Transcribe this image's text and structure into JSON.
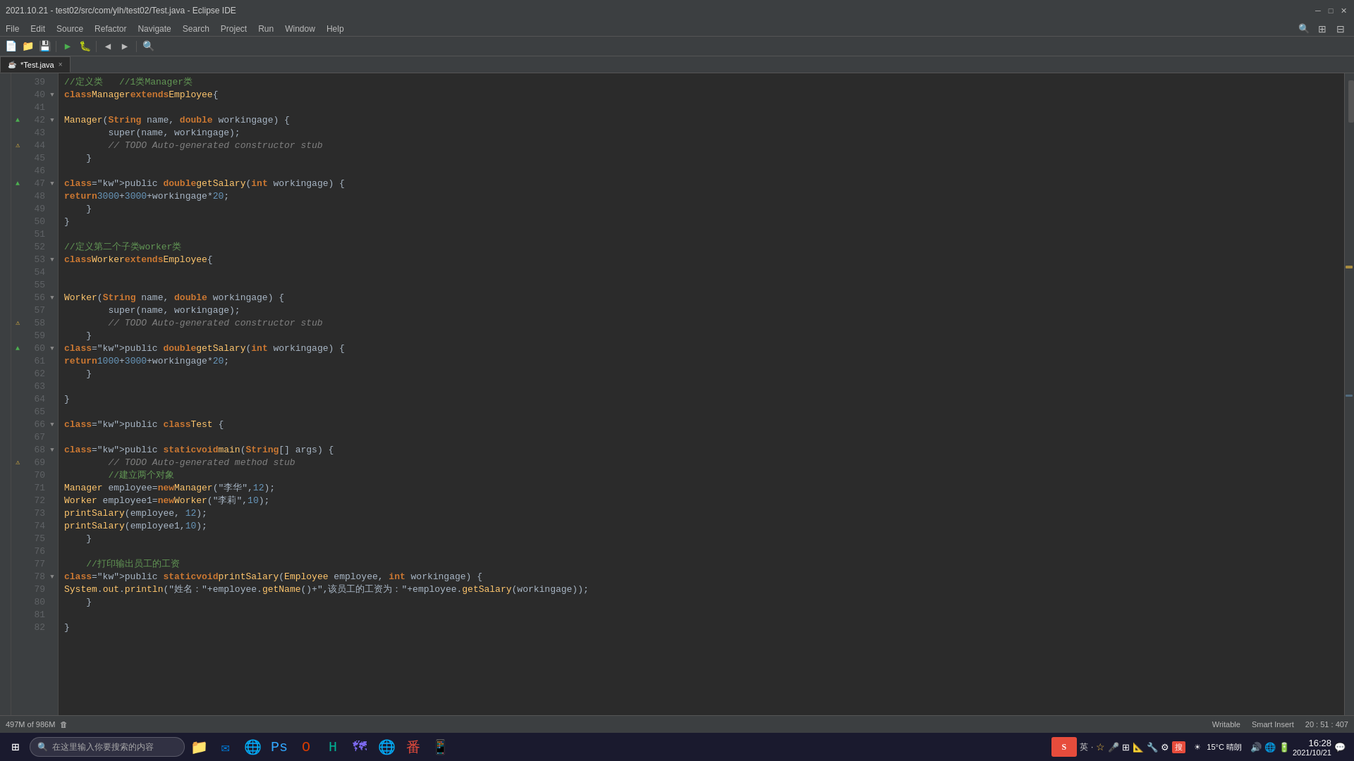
{
  "window": {
    "title": "2021.10.21 - test02/src/com/ylh/test02/Test.java - Eclipse IDE"
  },
  "menu": {
    "items": [
      "File",
      "Edit",
      "Source",
      "Refactor",
      "Navigate",
      "Search",
      "Project",
      "Run",
      "Window",
      "Help"
    ]
  },
  "tab": {
    "label": "*Test.java",
    "close": "×"
  },
  "status": {
    "memory": "497M of 986M",
    "writable": "Writable",
    "insert_mode": "Smart Insert",
    "cursor": "20 : 51 : 407"
  },
  "taskbar": {
    "search_placeholder": "在这里输入你要搜索的内容",
    "time": "16:28",
    "date": "2021/10/21",
    "weather": "15°C 晴朗"
  },
  "code_lines": [
    {
      "num": 39,
      "marker": "",
      "fold": "",
      "text": "//定义类   //1类Manager类"
    },
    {
      "num": 40,
      "marker": "",
      "fold": "▼",
      "text": "class Manager extends Employee{"
    },
    {
      "num": 41,
      "marker": "",
      "fold": "",
      "text": ""
    },
    {
      "num": 42,
      "marker": "▲",
      "fold": "▼",
      "text": "    Manager(String name, double workingage) {"
    },
    {
      "num": 43,
      "marker": "",
      "fold": "",
      "text": "        super(name, workingage);"
    },
    {
      "num": 44,
      "marker": "⚠",
      "fold": "",
      "text": "        // TODO Auto-generated constructor stub"
    },
    {
      "num": 45,
      "marker": "",
      "fold": "",
      "text": "    }"
    },
    {
      "num": 46,
      "marker": "",
      "fold": "",
      "text": ""
    },
    {
      "num": 47,
      "marker": "▲",
      "fold": "▼",
      "text": "    public double getSalary(int workingage) {"
    },
    {
      "num": 48,
      "marker": "",
      "fold": "",
      "text": "        return 3000+3000+workingage*20;"
    },
    {
      "num": 49,
      "marker": "",
      "fold": "",
      "text": "    }"
    },
    {
      "num": 50,
      "marker": "",
      "fold": "",
      "text": "}"
    },
    {
      "num": 51,
      "marker": "",
      "fold": "",
      "text": ""
    },
    {
      "num": 52,
      "marker": "",
      "fold": "",
      "text": "//定义第二个子类worker类"
    },
    {
      "num": 53,
      "marker": "",
      "fold": "▼",
      "text": "class Worker extends Employee{"
    },
    {
      "num": 54,
      "marker": "",
      "fold": "",
      "text": ""
    },
    {
      "num": 55,
      "marker": "",
      "fold": "",
      "text": ""
    },
    {
      "num": 56,
      "marker": "",
      "fold": "▼",
      "text": "    Worker(String name, double workingage) {"
    },
    {
      "num": 57,
      "marker": "",
      "fold": "",
      "text": "        super(name, workingage);"
    },
    {
      "num": 58,
      "marker": "⚠",
      "fold": "",
      "text": "        // TODO Auto-generated constructor stub"
    },
    {
      "num": 59,
      "marker": "",
      "fold": "",
      "text": "    }"
    },
    {
      "num": 60,
      "marker": "▲",
      "fold": "▼",
      "text": "    public double getSalary(int workingage) {"
    },
    {
      "num": 61,
      "marker": "",
      "fold": "",
      "text": "        return 1000+3000+workingage*20;"
    },
    {
      "num": 62,
      "marker": "",
      "fold": "",
      "text": "    }"
    },
    {
      "num": 63,
      "marker": "",
      "fold": "",
      "text": ""
    },
    {
      "num": 64,
      "marker": "",
      "fold": "",
      "text": "}"
    },
    {
      "num": 65,
      "marker": "",
      "fold": "",
      "text": ""
    },
    {
      "num": 66,
      "marker": "",
      "fold": "▼",
      "text": "public class Test {"
    },
    {
      "num": 67,
      "marker": "",
      "fold": "",
      "text": ""
    },
    {
      "num": 68,
      "marker": "",
      "fold": "▼",
      "text": "    public static void main(String[] args) {"
    },
    {
      "num": 69,
      "marker": "⚠",
      "fold": "",
      "text": "        // TODO Auto-generated method stub"
    },
    {
      "num": 70,
      "marker": "",
      "fold": "",
      "text": "        //建立两个对象"
    },
    {
      "num": 71,
      "marker": "",
      "fold": "",
      "text": "        Manager employee=new Manager(\"李华\",12);"
    },
    {
      "num": 72,
      "marker": "",
      "fold": "",
      "text": "        Worker employee1=new Worker(\"李莉\",10);"
    },
    {
      "num": 73,
      "marker": "",
      "fold": "",
      "text": "        printSalary(employee, 12);"
    },
    {
      "num": 74,
      "marker": "",
      "fold": "",
      "text": "        printSalary(employee1,10);"
    },
    {
      "num": 75,
      "marker": "",
      "fold": "",
      "text": "    }"
    },
    {
      "num": 76,
      "marker": "",
      "fold": "",
      "text": ""
    },
    {
      "num": 77,
      "marker": "",
      "fold": "",
      "text": "    //打印输出员工的工资"
    },
    {
      "num": 78,
      "marker": "",
      "fold": "▼",
      "text": "    public static void printSalary(Employee employee, int workingage) {"
    },
    {
      "num": 79,
      "marker": "",
      "fold": "",
      "text": "        System.out.println(\"姓名：\"+employee.getName()+\",该员工的工资为：\"+employee.getSalary(workingage));"
    },
    {
      "num": 80,
      "marker": "",
      "fold": "",
      "text": "    }"
    },
    {
      "num": 81,
      "marker": "",
      "fold": "",
      "text": ""
    },
    {
      "num": 82,
      "marker": "",
      "fold": "",
      "text": "}"
    }
  ]
}
